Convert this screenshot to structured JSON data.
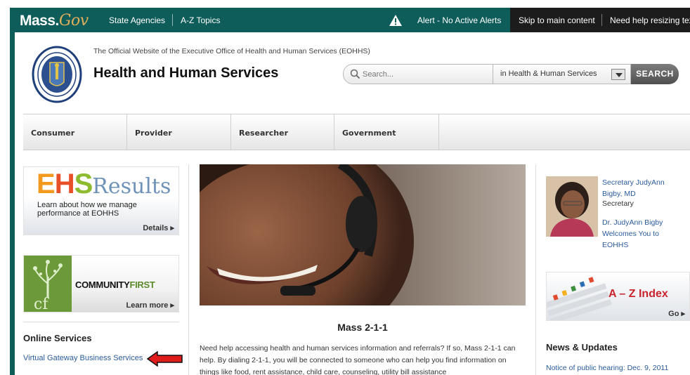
{
  "topbar": {
    "logo_main": "Mass.",
    "logo_gov": "Gov",
    "state_agencies": "State Agencies",
    "az_topics": "A-Z Topics",
    "alert": "Alert - No Active Alerts",
    "skip": "Skip to main content",
    "resize_help": "Need help resizing text"
  },
  "header": {
    "official": "The Official Website of the Executive Office of Health and Human Services (EOHHS)",
    "title": "Health and Human Services",
    "search_placeholder": "Search...",
    "scope": "in Health & Human Services",
    "search_button": "SEARCH"
  },
  "nav": {
    "tabs": [
      {
        "label": "Consumer"
      },
      {
        "label": "Provider"
      },
      {
        "label": "Researcher"
      },
      {
        "label": "Government"
      }
    ]
  },
  "left": {
    "ehs": {
      "logo_e": "E",
      "logo_h": "H",
      "logo_s": "S",
      "logo_results": "Results",
      "description": "Learn about how we manage performance at EOHHS",
      "details": "Details ▸"
    },
    "community": {
      "logo_letters": "cf",
      "title_a": "COMMUNITY",
      "title_b": "FIRST",
      "learn_more": "Learn more ▸"
    },
    "online_services": {
      "heading": "Online Services",
      "link": "Virtual Gateway Business Services"
    }
  },
  "center": {
    "feature_title": "Mass 2-1-1",
    "feature_body": "Need help accessing health and human services information and referrals? If so, Mass 2-1-1 can help. By dialing 2-1-1, you will be connected to someone who can help you find information on things like food, rent assistance, child care, counseling, utility bill assistance"
  },
  "right": {
    "secretary_name": "Secretary JudyAnn Bigby, MD",
    "secretary_role": "Secretary",
    "secretary_welcome": "Dr. JudyAnn Bigby Welcomes You to EOHHS",
    "az_title": "A – Z Index",
    "az_go": "Go ▸",
    "news_heading": "News & Updates",
    "news_item": "Notice of public hearing: Dec. 9, 2011"
  },
  "colors": {
    "brand_teal": "#0e5d5a",
    "link_blue": "#2a5b9b",
    "arrow_red": "#e01b1b"
  }
}
